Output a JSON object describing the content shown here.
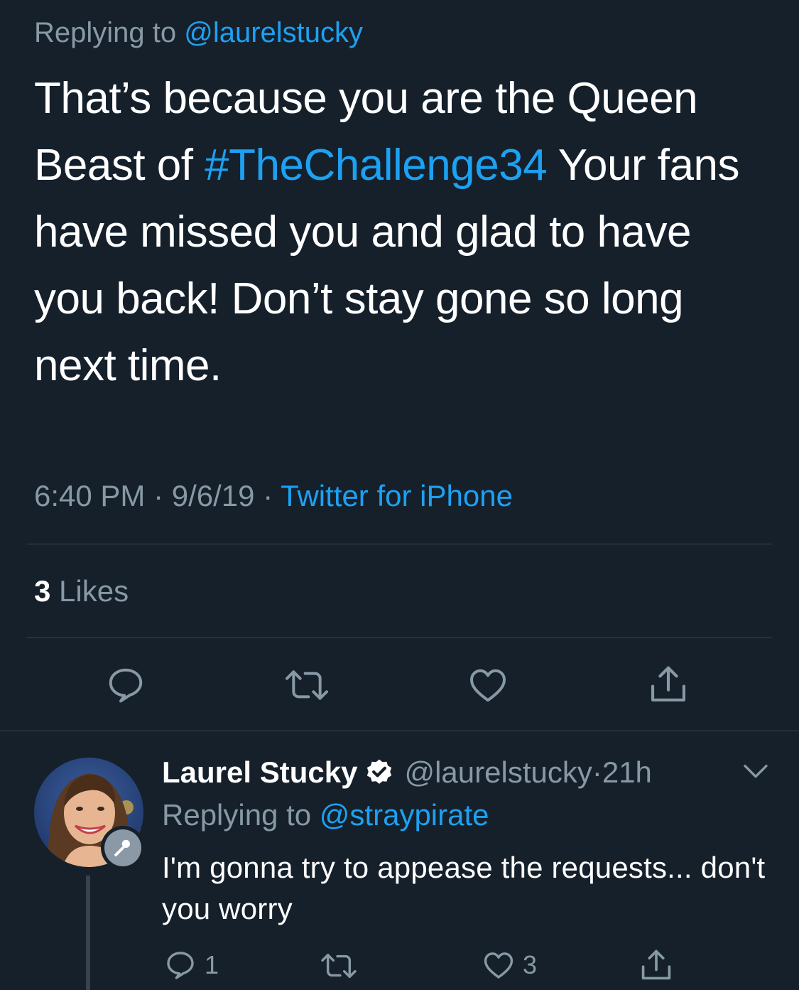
{
  "main_tweet": {
    "replying_prefix": "Replying to ",
    "replying_handle": "@laurelstucky",
    "text_part1": "That’s because you are the Queen Beast of ",
    "hashtag": "#TheChallenge34",
    "text_part2": " Your fans have missed you and glad to have you back! Don’t stay gone so long next time.",
    "time": "6:40 PM",
    "separator": " · ",
    "date": "9/6/19",
    "source": "Twitter for iPhone",
    "likes_count": "3",
    "likes_label": " Likes"
  },
  "reply_tweet": {
    "name": "Laurel Stucky",
    "handle": "@laurelstucky",
    "time_separator": " · ",
    "time": "21h",
    "replying_prefix": "Replying to ",
    "replying_handle": "@straypirate",
    "text": "I'm gonna try to appease the requests... don't you worry",
    "reply_count": "1",
    "like_count": "3"
  },
  "icons": {
    "reply": "comment-bubble-icon",
    "retweet": "retweet-icon",
    "like": "heart-icon",
    "share": "share-icon",
    "verified": "verified-badge-icon",
    "more": "chevron-down-icon",
    "mic": "microphone-icon"
  },
  "colors": {
    "background": "#15202b",
    "text": "#ffffff",
    "secondary": "#8899a6",
    "link": "#1da1f2",
    "divider": "#38444d"
  }
}
